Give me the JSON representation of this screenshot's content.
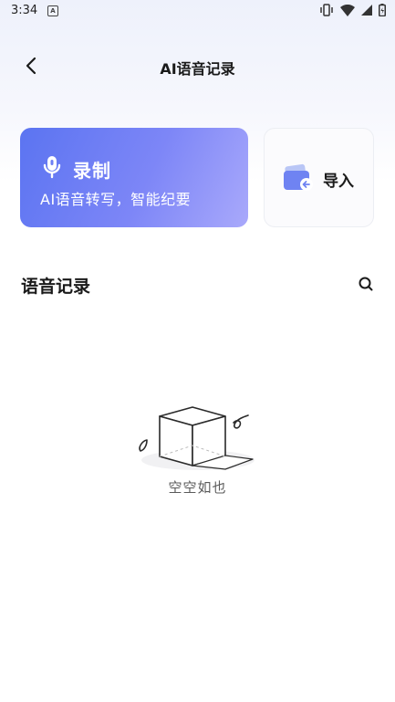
{
  "status_bar": {
    "time": "3:34",
    "a_icon": "A"
  },
  "header": {
    "title": "AI语音记录",
    "back_icon": "chevron-left-icon"
  },
  "record_card": {
    "label": "录制",
    "subtitle": "AI语音转写，智能纪要",
    "icon": "microphone-icon",
    "colors": [
      "#5b74f1",
      "#a9a9fb"
    ]
  },
  "import_card": {
    "label": "导入",
    "icon": "folder-import-icon"
  },
  "section": {
    "title": "语音记录",
    "search_icon": "search-icon"
  },
  "empty_state": {
    "text": "空空如也",
    "illustration": "empty-box-illustration"
  }
}
